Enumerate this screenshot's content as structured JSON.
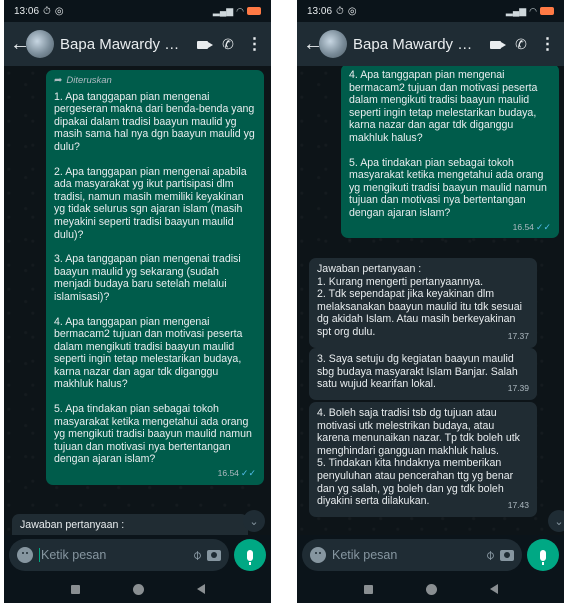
{
  "status": {
    "time": "13:06"
  },
  "header": {
    "contact_name": "Bapa Mawardy Hatt..."
  },
  "input": {
    "placeholder": "Ketik pesan"
  },
  "left": {
    "forwarded_label": "Diteruskan",
    "q1": "1. Apa tanggapan pian mengenai pergeseran makna dari benda-benda yang dipakai dalam tradisi baayun maulid yg masih sama hal nya dgn baayun maulid yg dulu?",
    "q2": "2. Apa tanggapan pian mengenai apabila ada masyarakat yg ikut partisipasi dlm tradisi, namun masih memiliki keyakinan yg tidak selurus sgn ajaran islam (masih meyakini seperti tradisi baayun maulid dulu)?",
    "q3": "3. Apa tanggapan pian mengenai tradisi baayun maulid yg sekarang (sudah menjadi budaya baru setelah melalui islamisasi)?",
    "q4": "4. Apa tanggapan pian mengenai bermacam2 tujuan dan motivasi peserta dalam mengikuti tradisi baayun maulid seperti ingin tetap melestarikan budaya, karna nazar dan agar tdk diganggu makhluk halus?",
    "q5": "5. Apa tindakan pian sebagai tokoh masyarakat ketika mengetahui ada orang yg mengikuti tradisi baayun maulid namun tujuan dan motivasi nya bertentangan dengan ajaran islam?",
    "sent_time": "16.54",
    "reply_preview": "Jawaban pertanyaan :"
  },
  "right": {
    "q4": "4. Apa tanggapan pian mengenai bermacam2 tujuan dan motivasi peserta dalam mengikuti tradisi baayun maulid seperti ingin tetap melestarikan budaya, karna nazar dan agar tdk diganggu makhluk halus?",
    "q5": "5. Apa tindakan pian sebagai tokoh masyarakat ketika mengetahui ada orang yg mengikuti tradisi baayun maulid namun tujuan dan motivasi nya bertentangan dengan ajaran islam?",
    "sent_time": "16.54",
    "reply1_text": "Jawaban pertanyaan :\n1. Kurang mengerti pertanyaannya.\n2. Tdk sependapat jika keyakinan dlm melaksanakan baayun maulid itu tdk sesuai dg akidah Islam. Atau masih berkeyakinan spt org dulu.",
    "reply1_time": "17.37",
    "reply2_text": "3. Saya setuju dg kegiatan baayun maulid sbg budaya masyarakt Islam Banjar. Salah satu wujud kearifan lokal.",
    "reply2_time": "17.39",
    "reply3_text": "4. Boleh saja tradisi tsb dg tujuan atau motivasi utk melestrikan budaya, atau karena menunaikan nazar. Tp tdk boleh utk menghindari gangguan makhluk halus.\n5. Tindakan kita hndaknya memberikan penyuluhan atau pencerahan ttg yg benar dan yg salah, yg boleh dan yg tdk boleh diyakini serta dilakukan.",
    "reply3_time": "17.43"
  },
  "colors": {
    "outgoing": "#005c4b",
    "incoming": "#202c33",
    "header": "#1f2c34",
    "accent": "#00a884",
    "read_ticks": "#53bdeb"
  }
}
